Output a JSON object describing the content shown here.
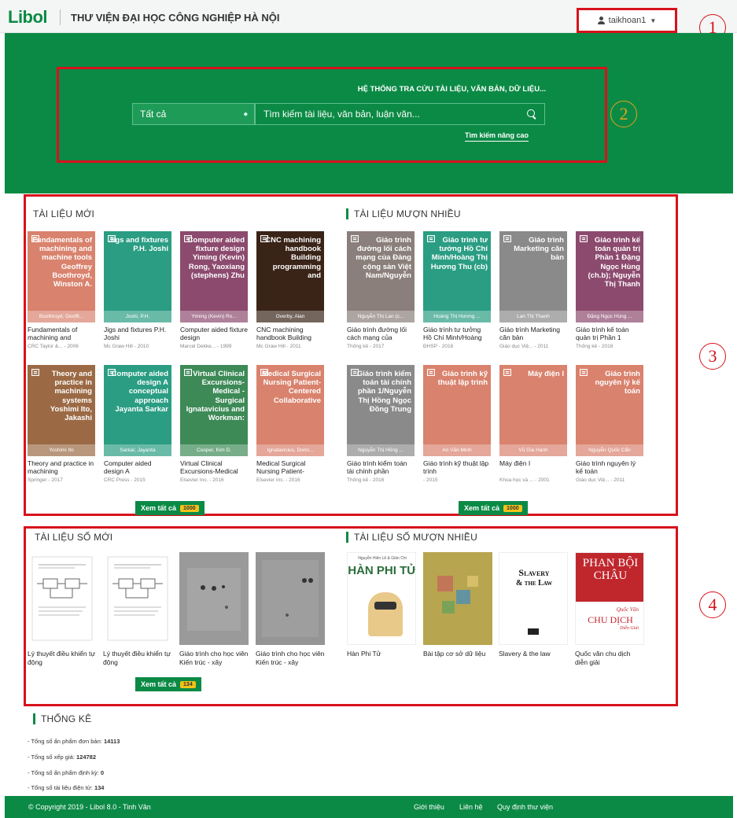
{
  "header": {
    "logo": "Libol",
    "site_title": "THƯ VIỆN ĐẠI HỌC CÔNG NGHIỆP HÀ NỘI",
    "username": "taikhoan1"
  },
  "annotations": [
    "1",
    "2",
    "3",
    "4"
  ],
  "search": {
    "slogan": "HỆ THỐNG TRA CỨU TÀI LIỆU, VĂN BẢN, DỮ LIỆU...",
    "category": "Tất cả",
    "placeholder": "Tìm kiếm tài liệu, văn bản, luận văn...",
    "advanced": "Tìm kiếm nâng cao"
  },
  "new_docs": {
    "heading": "TÀI LIỆU MỚI",
    "view_all": "Xem tất cả",
    "count": "1000",
    "items": [
      {
        "cover": "Fundamentals of machining and machine tools Geoffrey Boothroyd, Winston A.",
        "author": "Boothroyd, Geoffr...",
        "title": "Fundamentals of machining and",
        "meta": "CRC Taylor &... - 2006",
        "color": "#d9826d"
      },
      {
        "cover": "Jigs and fixtures P.H. Joshi",
        "author": "Joshi, P.H.",
        "title": "Jigs and fixtures P.H. Joshi",
        "meta": "Mc Graw Hill - 2010",
        "color": "#2a9d83"
      },
      {
        "cover": "Computer aided fixture design Yiming (Kevin) Rong, Yaoxiang (stephens) Zhu",
        "author": "Yiming (Kevin) Ro...",
        "title": "Computer aided fixture design",
        "meta": "Marcel Dekke... - 1999",
        "color": "#8c4a6e"
      },
      {
        "cover": "CNC machining handbook Building programming and",
        "author": "Overby, Alan",
        "title": "CNC machining handbook Building",
        "meta": "Mc Graw Hill - 2011",
        "color": "#3a2418"
      },
      {
        "cover": "Theory and practice in machining systems Yoshimi Ito, Jakashi",
        "author": "Yoshimi Ito",
        "title": "Theory and practice in machining",
        "meta": "Springer - 2017",
        "color": "#9b6a45"
      },
      {
        "cover": "Computer aided design A conceptual approach Jayanta Sarkar",
        "author": "Sarkar, Jayanta",
        "title": "Computer aided design A",
        "meta": "CRC Press - 2015",
        "color": "#2a9d83"
      },
      {
        "cover": "Virtual Clinical Excursions-Medical - Surgical Ignatavicius and Workman:",
        "author": "Cooper, Kim D.",
        "title": "Virtual Clinical Excursions-Medical",
        "meta": "Elsevier Inc. - 2016",
        "color": "#3d8a57"
      },
      {
        "cover": "Medical Surgical Nursing Patient-Centered Collaborative",
        "author": "Ignatavicius, Donn...",
        "title": "Medical Surgical Nursing Patient-",
        "meta": "Elsevier Inc. - 2016",
        "color": "#d9826d"
      }
    ]
  },
  "popular_docs": {
    "heading": "TÀI LIỆU MƯỢN NHIỀU",
    "view_all": "Xem tất cả",
    "count": "1000",
    "items": [
      {
        "cover": "Giáo trình đường lối cách mạng của Đảng cộng sản Việt Nam/Nguyễn",
        "author": "Nguyễn Thị Lan (c...",
        "title": "Giáo trình đường lối cách mạng của",
        "meta": "Thống kê - 2017",
        "color": "#8a7f7a"
      },
      {
        "cover": "Giáo trình tư tưởng Hồ Chí Minh/Hoàng Thị Hương Thu (cb)",
        "author": "Hoàng Thị Hương ...",
        "title": "Giáo trình tư tưởng Hồ Chí Minh/Hoàng",
        "meta": "ĐHSP - 2016",
        "color": "#2a9d83"
      },
      {
        "cover": "Giáo trình Marketing căn bản",
        "author": "Lan Thị Thanh",
        "title": "Giáo trình Marketing căn bản",
        "meta": "Giáo dục Việ... - 2011",
        "color": "#8a8a8a"
      },
      {
        "cover": "Giáo trình kế toán quản trị Phần 1 Đặng Ngọc Hùng (ch.b); Nguyễn Thị Thanh",
        "author": "Đặng Ngọc Hùng ...",
        "title": "Giáo trình kế toán quản trị Phần 1",
        "meta": "Thống kê - 2016",
        "color": "#8c4a6e"
      },
      {
        "cover": "Giáo trình kiểm toán tài chính phần 1/Nguyễn Thị Hồng Ngọc Đồng Trung",
        "author": "Nguyễn Thị Hồng ...",
        "title": "Giáo trình kiểm toán tài chính phần",
        "meta": "Thống kê - 2016",
        "color": "#8a8a8a"
      },
      {
        "cover": "Giáo trình kỹ thuật lập trình",
        "author": "An Văn Minh",
        "title": "Giáo trình kỹ thuật lập trình",
        "meta": "- 2015",
        "color": "#d9826d"
      },
      {
        "cover": "Máy điện I",
        "author": "Vũ Gia Hanh",
        "title": "Máy điện I",
        "meta": "Khoa học và ... - 2001",
        "color": "#d9826d"
      },
      {
        "cover": "Giáo trình nguyên lý kế toán",
        "author": "Nguyễn Quốc Cẩn",
        "title": "Giáo trình nguyên lý kế toán",
        "meta": "Giáo dục Việ... - 2011",
        "color": "#d9826d"
      }
    ]
  },
  "new_digital": {
    "heading": "TÀI LIỆU SỐ MỚI",
    "view_all": "Xem tất cả",
    "count": "134",
    "items": [
      {
        "title": "Lý thuyết điều khiển tự động"
      },
      {
        "title": "Lý thuyết điều khiển tự động"
      },
      {
        "title": "Giáo trình cho học viên Kiến trúc - xây"
      },
      {
        "title": "Giáo trình cho học viên Kiến trúc - xây"
      }
    ]
  },
  "popular_digital": {
    "heading": "TÀI LIỆU SỐ MƯỢN NHIỀU",
    "items": [
      {
        "title": "Hàn Phi Tử",
        "cover_text": "HÀN PHI TỬ",
        "cover_top": "Nguyễn Hiến Lê & Giản Chi"
      },
      {
        "title": "Bài tập cơ sở dữ liệu"
      },
      {
        "title": "Slavery & the law",
        "cover_text_1": "Slavery",
        "cover_text_2": "& the Law"
      },
      {
        "title": "Quốc văn chu dịch diễn giải",
        "cover_text_1": "PHAN BỘI CHÂU",
        "cover_text_2": "Quốc Văn",
        "cover_text_3": "CHU DỊCH",
        "cover_text_4": "Diễn Giải"
      }
    ]
  },
  "stats": {
    "heading": "THỐNG KÊ",
    "lines": [
      {
        "label": "- Tổng số ấn phẩm đơn bản:",
        "value": "14113"
      },
      {
        "label": "- Tổng số xếp giá:",
        "value": "124782"
      },
      {
        "label": "- Tổng số ấn phẩm định kỳ:",
        "value": "0"
      },
      {
        "label": "- Tổng số tài liệu điện tử:",
        "value": "134"
      }
    ]
  },
  "footer": {
    "copyright": "© Copyright 2019 - Libol 8.0 - Tinh Vân",
    "links": [
      "Giới thiệu",
      "Liên hệ",
      "Quy định thư viện"
    ]
  },
  "colors": {
    "brand": "#0b8a45",
    "annotation": "#d7121c"
  }
}
